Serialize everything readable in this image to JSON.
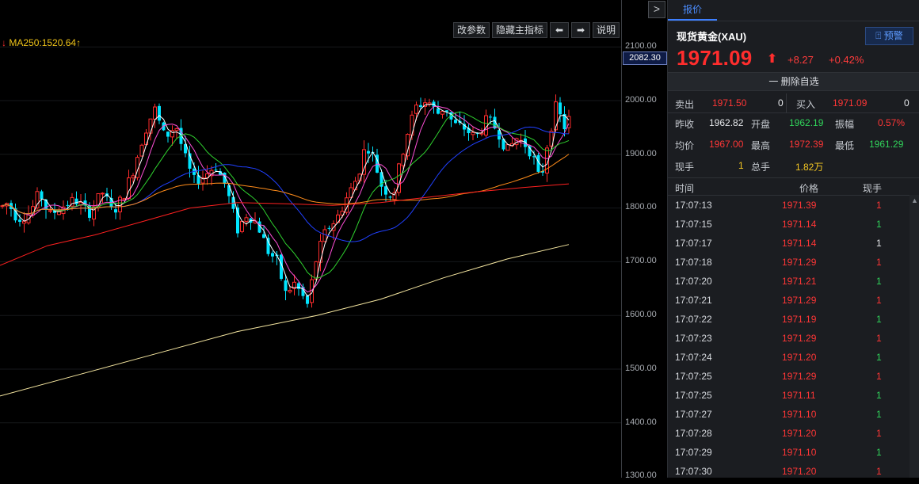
{
  "chart": {
    "toolbar": {
      "params_label": "改参数",
      "hide_indicators_label": "隐藏主指标",
      "left_arrow": "⬅",
      "right_arrow": "➡",
      "help_label": "说明"
    },
    "collapse_glyph": ">",
    "ma_legend": {
      "prefix_arrow": "↓",
      "text": "MA250:1520.64",
      "suffix_arrow": "↑"
    },
    "price_axis": {
      "labels": [
        "2100.00",
        "2000.00",
        "1900.00",
        "1800.00",
        "1700.00",
        "1600.00",
        "1500.00",
        "1400.00",
        "1300.00"
      ],
      "current": "2082.30"
    },
    "colors": {
      "up": "#ff2d2d",
      "down": "#00e5ff",
      "ma5": "#ffffff",
      "ma10": "#ff4fd8",
      "ma20": "#2fd12f",
      "ma60": "#2040ff",
      "ma120": "#ff8c1a",
      "ma180": "#ff2020",
      "ma250": "#f5e6a0"
    }
  },
  "chart_data": {
    "type": "candlestick",
    "title": "",
    "ylim": [
      1300,
      2100
    ],
    "y_ticks": [
      2100,
      2000,
      1900,
      1800,
      1700,
      1600,
      1500,
      1400,
      1300
    ],
    "series": [
      {
        "name": "MA250",
        "end_value": 1520.64
      }
    ]
  },
  "panel": {
    "tab_label": "报价",
    "instrument_name": "现货黄金(XAU)",
    "alert_label": "预警",
    "last_price": "1971.09",
    "arrow": "⬆",
    "change_abs": "+8.27",
    "change_pct": "+0.42%",
    "watchlist_label": "一 删除自选",
    "sell_label": "卖出",
    "sell_price": "1971.50",
    "sell_vol": "0",
    "buy_label": "买入",
    "buy_price": "1971.09",
    "buy_vol": "0",
    "prev_close_label": "昨收",
    "prev_close": "1962.82",
    "open_label": "开盘",
    "open": "1962.19",
    "amplitude_label": "振幅",
    "amplitude": "0.57%",
    "avg_label": "均价",
    "avg": "1967.00",
    "high_label": "最高",
    "high": "1972.39",
    "low_label": "最低",
    "low": "1961.29",
    "cur_vol_label": "现手",
    "cur_vol": "1",
    "total_vol_label": "总手",
    "total_vol": "1.82万",
    "ticks_header": {
      "time": "时间",
      "price": "价格",
      "vol": "现手"
    },
    "ticks": [
      {
        "time": "17:07:13",
        "price": "1971.39",
        "vol": "1",
        "dir": "up"
      },
      {
        "time": "17:07:15",
        "price": "1971.14",
        "vol": "1",
        "dir": "down"
      },
      {
        "time": "17:07:17",
        "price": "1971.14",
        "vol": "1",
        "dir": "flat"
      },
      {
        "time": "17:07:18",
        "price": "1971.29",
        "vol": "1",
        "dir": "up"
      },
      {
        "time": "17:07:20",
        "price": "1971.21",
        "vol": "1",
        "dir": "down"
      },
      {
        "time": "17:07:21",
        "price": "1971.29",
        "vol": "1",
        "dir": "up"
      },
      {
        "time": "17:07:22",
        "price": "1971.19",
        "vol": "1",
        "dir": "down"
      },
      {
        "time": "17:07:23",
        "price": "1971.29",
        "vol": "1",
        "dir": "up"
      },
      {
        "time": "17:07:24",
        "price": "1971.20",
        "vol": "1",
        "dir": "down"
      },
      {
        "time": "17:07:25",
        "price": "1971.29",
        "vol": "1",
        "dir": "up"
      },
      {
        "time": "17:07:25",
        "price": "1971.11",
        "vol": "1",
        "dir": "down"
      },
      {
        "time": "17:07:27",
        "price": "1971.10",
        "vol": "1",
        "dir": "down"
      },
      {
        "time": "17:07:28",
        "price": "1971.20",
        "vol": "1",
        "dir": "up"
      },
      {
        "time": "17:07:29",
        "price": "1971.10",
        "vol": "1",
        "dir": "down"
      },
      {
        "time": "17:07:30",
        "price": "1971.20",
        "vol": "1",
        "dir": "up"
      }
    ]
  }
}
